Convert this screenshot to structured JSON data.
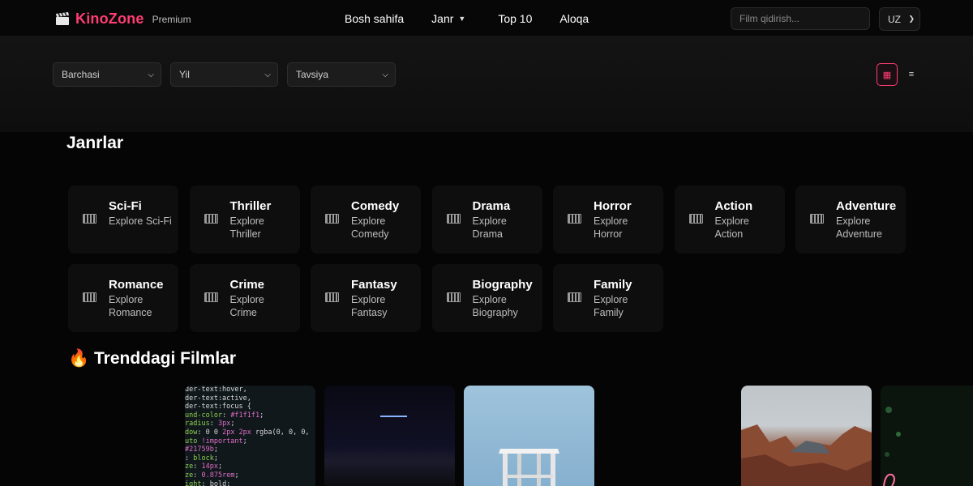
{
  "header": {
    "logo_icon": "clapperboard-icon",
    "brand": "KinoZone",
    "tier": "Premium",
    "nav": [
      "Bosh sahifa",
      "Janr",
      "Top 10",
      "Aloqa"
    ],
    "search_placeholder": "Film qidirish...",
    "language": "UZ"
  },
  "filters": {
    "category": "Barchasi",
    "year": "Yil",
    "sort": "Tavsiya",
    "view_modes": [
      "grid-icon",
      "list-icon"
    ]
  },
  "genres_section": {
    "title": "Janrlar",
    "items": [
      {
        "name": "Sci-Fi",
        "desc": "Explore Sci-Fi"
      },
      {
        "name": "Thriller",
        "desc": "Explore Thriller"
      },
      {
        "name": "Comedy",
        "desc": "Explore Comedy"
      },
      {
        "name": "Drama",
        "desc": "Explore Drama"
      },
      {
        "name": "Horror",
        "desc": "Explore Horror"
      },
      {
        "name": "Action",
        "desc": "Explore Action"
      },
      {
        "name": "Adventure",
        "desc": "Explore Adventure"
      },
      {
        "name": "Romance",
        "desc": "Explore Romance"
      },
      {
        "name": "Crime",
        "desc": "Explore Crime"
      },
      {
        "name": "Fantasy",
        "desc": "Explore Fantasy"
      },
      {
        "name": "Biography",
        "desc": "Explore Biography"
      },
      {
        "name": "Family",
        "desc": "Explore Family"
      }
    ]
  },
  "trending": {
    "icon": "fire-icon",
    "title": "Trenddagi Filmlar"
  },
  "colors": {
    "accent": "#ff3d72",
    "background": "#050505",
    "card": "#0e0e0e"
  }
}
